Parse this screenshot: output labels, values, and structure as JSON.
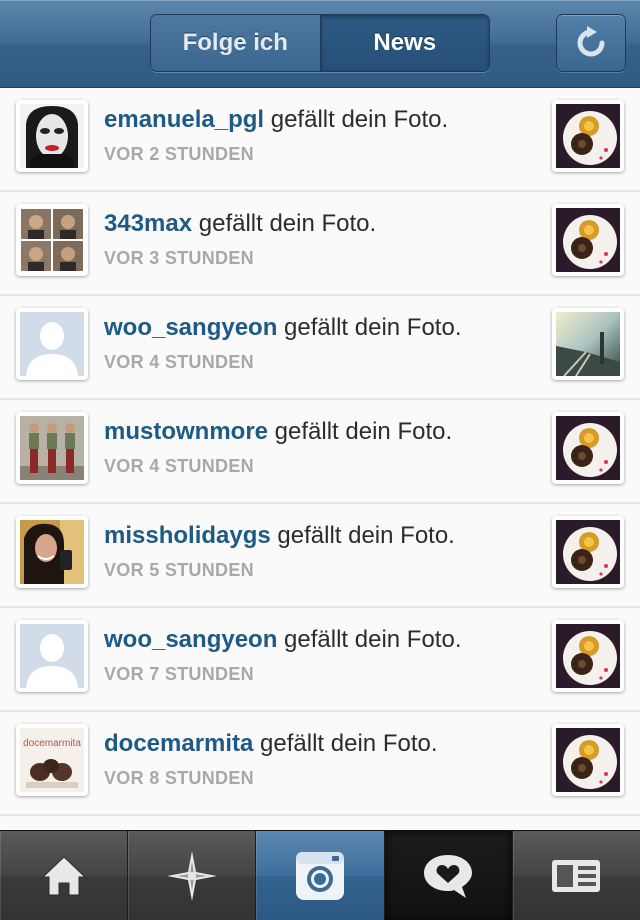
{
  "header": {
    "segments": [
      {
        "label": "Folge ich",
        "selected": false
      },
      {
        "label": "News",
        "selected": true
      }
    ],
    "refresh_icon": "refresh-icon"
  },
  "feed": {
    "items": [
      {
        "user": "emanuela_pgl",
        "action": " gefällt dein Foto.",
        "time": "VOR 2 STUNDEN",
        "avatar": "portrait-photo",
        "thumb": "cake-photo"
      },
      {
        "user": "343max",
        "action": " gefällt dein Foto.",
        "time": "VOR 3 STUNDEN",
        "avatar": "photobooth-collage",
        "thumb": "cake-photo"
      },
      {
        "user": "woo_sangyeon",
        "action": " gefällt dein Foto.",
        "time": "VOR 4 STUNDEN",
        "avatar": "default-avatar",
        "thumb": "street-photo"
      },
      {
        "user": "mustownmore",
        "action": " gefällt dein Foto.",
        "time": "VOR 4 STUNDEN",
        "avatar": "group-photo",
        "thumb": "cake-photo"
      },
      {
        "user": "missholidaygs",
        "action": " gefällt dein Foto.",
        "time": "VOR 5 STUNDEN",
        "avatar": "selfie-photo",
        "thumb": "cake-photo"
      },
      {
        "user": "woo_sangyeon",
        "action": " gefällt dein Foto.",
        "time": "VOR 7 STUNDEN",
        "avatar": "default-avatar",
        "thumb": "cake-photo"
      },
      {
        "user": "docemarmita",
        "action": " gefällt dein Foto.",
        "time": "VOR 8 STUNDEN",
        "avatar": "docemarmita-logo",
        "avatar_text": "docemarmita",
        "thumb": "cake-photo"
      }
    ]
  },
  "tabbar": {
    "tabs": [
      {
        "icon": "home-icon",
        "selected": false
      },
      {
        "icon": "explore-icon",
        "selected": false
      },
      {
        "icon": "camera-icon",
        "selected": false
      },
      {
        "icon": "news-icon",
        "selected": true
      },
      {
        "icon": "profile-icon",
        "selected": false
      }
    ]
  },
  "colors": {
    "header_blue": "#3a668f",
    "username_blue": "#1e5a85",
    "time_gray": "#a8a8a8",
    "tab_dark": "#333333"
  }
}
